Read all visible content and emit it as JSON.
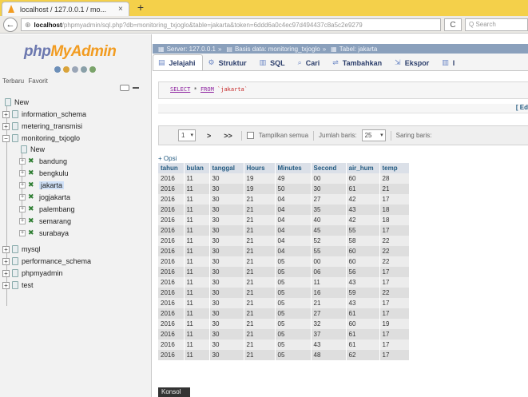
{
  "browser": {
    "tab_title": "localhost / 127.0.0.1 / mo...",
    "tab_close": "×",
    "new_tab": "+",
    "back": "←",
    "url_globe": "⊕",
    "url_host": "localhost",
    "url_rest": "/phpmyadmin/sql.php?db=monitoring_txjoglo&table=jakarta&token=6ddd6a0c4ec97d494437c8a5c2e9279",
    "reload": "C",
    "search_placeholder": "Q Search"
  },
  "logo": {
    "part1": "php",
    "part2": "MyAdmin"
  },
  "nav_links": [
    "Terbaru",
    "Favorit"
  ],
  "tree": {
    "new_label": "New",
    "databases": [
      "information_schema",
      "metering_transmisi",
      "monitoring_txjoglo"
    ],
    "sub_new_label": "New",
    "tables": [
      "bandung",
      "bengkulu",
      "jakarta",
      "jogjakarta",
      "palembang",
      "semarang",
      "surabaya"
    ],
    "databases_after": [
      "mysql",
      "performance_schema",
      "phpmyadmin",
      "test"
    ]
  },
  "breadcrumb": {
    "server": "Server: 127.0.0.1",
    "database": "Basis data: monitoring_txjoglo",
    "table": "Tabel: jakarta",
    "separator": "»"
  },
  "tabs": [
    {
      "icon": "▤",
      "label": "Jelajahi"
    },
    {
      "icon": "⚙",
      "label": "Struktur"
    },
    {
      "icon": "▥",
      "label": "SQL"
    },
    {
      "icon": "⌕",
      "label": "Cari"
    },
    {
      "icon": "⇌",
      "label": "Tambahkan"
    },
    {
      "icon": "⇲",
      "label": "Ekspor"
    },
    {
      "icon": "▥",
      "label": "I"
    }
  ],
  "sql": {
    "select": "SELECT",
    "star": " * ",
    "from": "FROM",
    "table": " `jakarta`"
  },
  "edit_link": "[ Ed",
  "pager": {
    "page_value": "1",
    "dropdown_arrow": "▾",
    "next": ">",
    "last": ">>",
    "show_all": "Tampilkan semua",
    "rows_label": "Jumlah baris:",
    "rows_value": "25",
    "filter_label": "Saring baris:"
  },
  "options_link": "+ Opsi",
  "table": {
    "columns": [
      "tahun",
      "bulan",
      "tanggal",
      "Hours",
      "Minutes",
      "Second",
      "air_hum",
      "temp"
    ],
    "rows": [
      [
        "2016",
        "11",
        "30",
        "19",
        "49",
        "00",
        "60",
        "28"
      ],
      [
        "2016",
        "11",
        "30",
        "19",
        "50",
        "30",
        "61",
        "21"
      ],
      [
        "2016",
        "11",
        "30",
        "21",
        "04",
        "27",
        "42",
        "17"
      ],
      [
        "2016",
        "11",
        "30",
        "21",
        "04",
        "35",
        "43",
        "18"
      ],
      [
        "2016",
        "11",
        "30",
        "21",
        "04",
        "40",
        "42",
        "18"
      ],
      [
        "2016",
        "11",
        "30",
        "21",
        "04",
        "45",
        "55",
        "17"
      ],
      [
        "2016",
        "11",
        "30",
        "21",
        "04",
        "52",
        "58",
        "22"
      ],
      [
        "2016",
        "11",
        "30",
        "21",
        "04",
        "55",
        "60",
        "22"
      ],
      [
        "2016",
        "11",
        "30",
        "21",
        "05",
        "00",
        "60",
        "22"
      ],
      [
        "2016",
        "11",
        "30",
        "21",
        "05",
        "06",
        "56",
        "17"
      ],
      [
        "2016",
        "11",
        "30",
        "21",
        "05",
        "11",
        "43",
        "17"
      ],
      [
        "2016",
        "11",
        "30",
        "21",
        "05",
        "16",
        "59",
        "22"
      ],
      [
        "2016",
        "11",
        "30",
        "21",
        "05",
        "21",
        "43",
        "17"
      ],
      [
        "2016",
        "11",
        "30",
        "21",
        "05",
        "27",
        "61",
        "17"
      ],
      [
        "2016",
        "11",
        "30",
        "21",
        "05",
        "32",
        "60",
        "19"
      ],
      [
        "2016",
        "11",
        "30",
        "21",
        "05",
        "37",
        "61",
        "17"
      ],
      [
        "2016",
        "11",
        "30",
        "21",
        "05",
        "43",
        "61",
        "17"
      ],
      [
        "2016",
        "11",
        "30",
        "21",
        "05",
        "48",
        "62",
        "17"
      ]
    ]
  },
  "console": "Konsol"
}
